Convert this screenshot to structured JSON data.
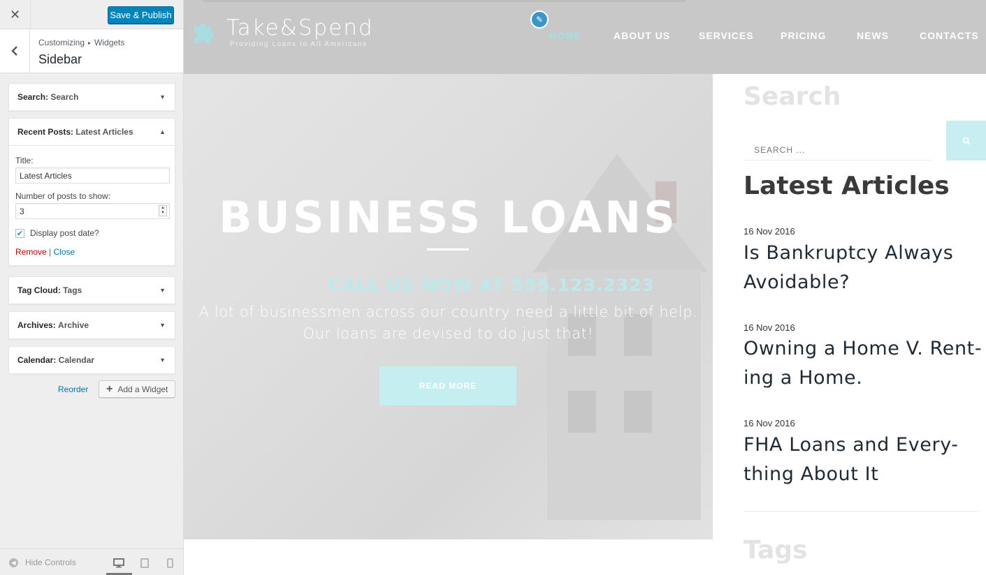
{
  "customizer": {
    "close_icon": "close-icon",
    "save_label": "Save & Publish",
    "breadcrumb": [
      "Customizing",
      "Widgets"
    ],
    "breadcrumb_sep": "▸",
    "section_title": "Sidebar",
    "widgets": [
      {
        "type": "Search:",
        "title": "Search",
        "expanded": false
      },
      {
        "type": "Recent Posts:",
        "title": "Latest Articles",
        "expanded": true
      },
      {
        "type": "Tag Cloud:",
        "title": "Tags",
        "expanded": false
      },
      {
        "type": "Archives:",
        "title": "Archive",
        "expanded": false
      },
      {
        "type": "Calendar:",
        "title": "Calendar",
        "expanded": false
      }
    ],
    "recent_posts_form": {
      "title_label": "Title:",
      "title_value": "Latest Articles",
      "number_label": "Number of posts to show:",
      "number_value": "3",
      "display_date_label": "Display post date?",
      "display_date_checked": true,
      "remove_label": "Remove",
      "link_sep": "|",
      "close_label": "Close"
    },
    "reorder_label": "Reorder",
    "add_widget_label": "Add a Widget",
    "hide_controls_label": "Hide Controls"
  },
  "preview": {
    "logo_text": "Take&Spend",
    "logo_tagline": "Providing Loans to All Americans",
    "nav": [
      "HOME",
      "ABOUT US",
      "SERVICES",
      "PRICING",
      "NEWS",
      "CONTACTS"
    ],
    "nav_active": "HOME",
    "hero_title": "BUSINESS LOANS",
    "hero_phone": "CALL US NOW AT 555.123.2323",
    "hero_desc_line1": "A lot of businessmen across our country need a little bit of help.",
    "hero_desc_line2": "Our loans are devised to do just that!",
    "read_more": "READ MORE",
    "sidebar": {
      "search_title": "Search",
      "search_placeholder": "SEARCH ...",
      "latest_title": "Latest Articles",
      "posts": [
        {
          "date": "16 Nov 2016",
          "title_line1": "Is Bankruptcy Always",
          "title_line2": "Avoidable?"
        },
        {
          "date": "16 Nov 2016",
          "title_line1": "Owning a Home V. Rent-",
          "title_line2": "ing a Home."
        },
        {
          "date": "16 Nov 2016",
          "title_line1": "FHA Loans and Every-",
          "title_line2": "thing About It"
        }
      ],
      "tags_title": "Tags"
    }
  },
  "colors": {
    "primary_button": "#0085ba",
    "accent": "#a8dde2",
    "link": "#0073aa",
    "remove": "#aa0000"
  }
}
